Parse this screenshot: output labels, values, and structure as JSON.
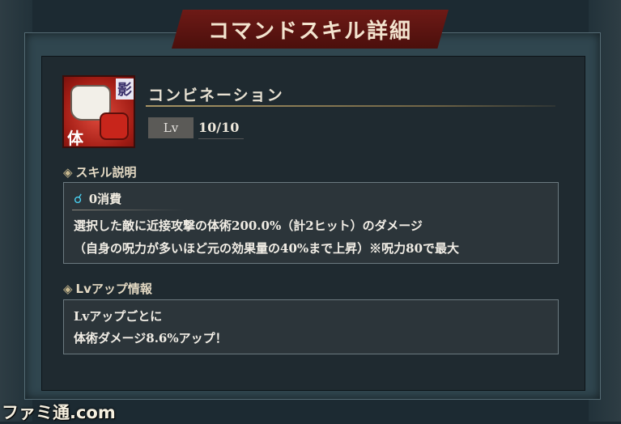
{
  "window": {
    "title": "コマンドスキル詳細"
  },
  "skill": {
    "icon": "fist-icon",
    "icon_kanji_type": "体",
    "icon_kanji_attr": "影",
    "name": "コンビネーション",
    "level_label": "Lv",
    "level_value": "10/10"
  },
  "description_section": {
    "heading": "スキル説明",
    "cost_icon": "spirit-drop-icon",
    "cost_text": "0消費",
    "lines": [
      "選択した敵に近接攻撃の体術200.0%（計2ヒット）のダメージ",
      "（自身の呪力が多いほど元の効果量の40%まで上昇）※呪力80で最大"
    ]
  },
  "levelup_section": {
    "heading": "Lvアップ情報",
    "lines": [
      "Lvアップごとに",
      "体術ダメージ8.6%アップ！"
    ]
  },
  "watermark": "ファミ通.com",
  "colors": {
    "banner": "#6e1a16",
    "panel": "#1f2a30",
    "accent_gold": "#a89565",
    "cost_icon": "#4ad0f0"
  }
}
